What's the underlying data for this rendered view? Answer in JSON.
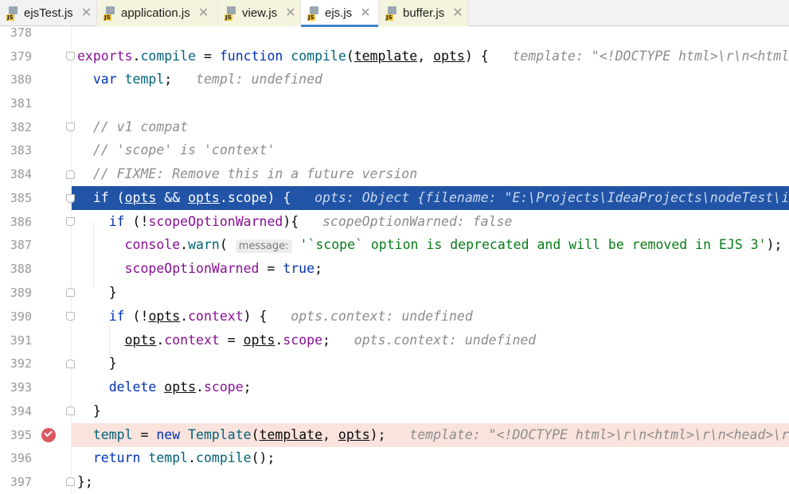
{
  "tabs": [
    {
      "label": "ejsTest.js",
      "icon": "js-file-icon",
      "close": "✕"
    },
    {
      "label": "application.js",
      "icon": "js-file-icon",
      "close": "✕"
    },
    {
      "label": "view.js",
      "icon": "js-file-icon",
      "close": "✕"
    },
    {
      "label": "ejs.js",
      "icon": "js-file-icon",
      "close": "✕",
      "active": true
    },
    {
      "label": "buffer.js",
      "icon": "js-file-icon",
      "close": "✕"
    }
  ],
  "colors": {
    "execution_line": "#2154a6",
    "breakpoint_line": "#fae3dd",
    "breakpoint": "#db5860",
    "active_tab_indicator": "#4083c9"
  },
  "editor": {
    "line_numbers": [
      "378",
      "379",
      "380",
      "381",
      "382",
      "383",
      "384",
      "385",
      "386",
      "387",
      "388",
      "389",
      "390",
      "391",
      "392",
      "393",
      "394",
      "395",
      "396",
      "397"
    ],
    "debug_values": {
      "l379": "template: \"<!DOCTYPE html>\\r\\n<html",
      "l380": "templ: undefined",
      "l385": "opts: Object {filename: \"E:\\Projects\\IdeaProjects\\nodeTest\\i",
      "l386": "scopeOptionWarned: false",
      "l390": "opts.context: undefined",
      "l391": "opts.context: undefined",
      "l395": "template: \"<!DOCTYPE html>\\r\\n<html>\\r\\n<head>\\r"
    },
    "param_hint": "message:",
    "strings": {
      "deprecation": "'`scope` option is deprecated and will be removed in EJS 3'"
    },
    "comments": {
      "c382": "// v1 compat",
      "c383": "// 'scope' is 'context'",
      "c384": "// FIXME: Remove this in a future version"
    }
  }
}
